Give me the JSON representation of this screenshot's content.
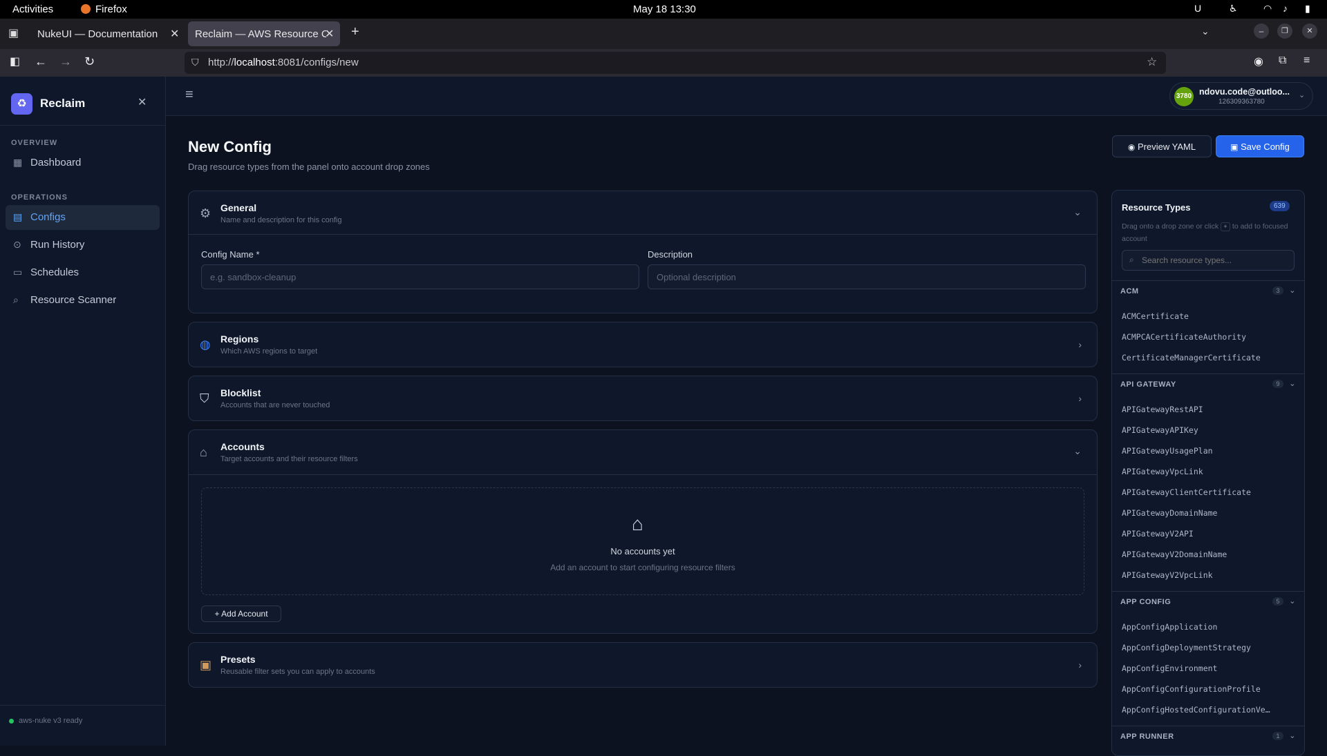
{
  "os_bar": {
    "activities": "Activities",
    "app": "Firefox",
    "clock": "May 18  13:30"
  },
  "browser": {
    "tabs": [
      {
        "label": "NukeUI — Documentation"
      },
      {
        "label": "Reclaim — AWS Resource Cc"
      }
    ],
    "url_prefix": "http://",
    "url_host": "localhost",
    "url_rest": ":8081/configs/new"
  },
  "sidebar": {
    "brand": "Reclaim",
    "sections": {
      "overview": "OVERVIEW",
      "operations": "OPERATIONS"
    },
    "items": {
      "dashboard": "Dashboard",
      "configs": "Configs",
      "run_history": "Run History",
      "schedules": "Schedules",
      "scanner": "Resource Scanner"
    },
    "status": "aws-nuke v3 ready"
  },
  "account": {
    "badge": "3780",
    "email": "ndovu.code@outloo...",
    "id": "126309363780"
  },
  "page": {
    "title": "New Config",
    "subtitle": "Drag resource types from the panel onto account drop zones",
    "preview_button": "Preview YAML",
    "save_button": "Save Config"
  },
  "general": {
    "title": "General",
    "subtitle": "Name and description for this config",
    "name_label": "Config Name *",
    "name_placeholder": "e.g. sandbox-cleanup",
    "desc_label": "Description",
    "desc_placeholder": "Optional description"
  },
  "regions": {
    "title": "Regions",
    "subtitle": "Which AWS regions to target"
  },
  "blocklist": {
    "title": "Blocklist",
    "subtitle": "Accounts that are never touched"
  },
  "accounts": {
    "title": "Accounts",
    "subtitle": "Target accounts and their resource filters",
    "empty_title": "No accounts yet",
    "empty_sub": "Add an account to start configuring resource filters",
    "add_button": "Add Account"
  },
  "presets": {
    "title": "Presets",
    "subtitle": "Reusable filter sets you can apply to accounts"
  },
  "resource_panel": {
    "title": "Resource Types",
    "count": "639",
    "hint_a": "Drag onto a drop zone or click",
    "hint_b": "to add to",
    "hint_c": "focused account",
    "search_placeholder": "Search resource types...",
    "groups": [
      {
        "name": "ACM",
        "count": "3",
        "items": [
          "ACMCertificate",
          "ACMPCACertificateAuthority",
          "CertificateManagerCertificate"
        ]
      },
      {
        "name": "API GATEWAY",
        "count": "9",
        "items": [
          "APIGatewayRestAPI",
          "APIGatewayAPIKey",
          "APIGatewayUsagePlan",
          "APIGatewayVpcLink",
          "APIGatewayClientCertificate",
          "APIGatewayDomainName",
          "APIGatewayV2API",
          "APIGatewayV2DomainName",
          "APIGatewayV2VpcLink"
        ]
      },
      {
        "name": "APP CONFIG",
        "count": "5",
        "items": [
          "AppConfigApplication",
          "AppConfigDeploymentStrategy",
          "AppConfigEnvironment",
          "AppConfigConfigurationProfile",
          "AppConfigHostedConfigurationVe…"
        ]
      },
      {
        "name": "APP RUNNER",
        "count": "1",
        "items": []
      }
    ]
  }
}
